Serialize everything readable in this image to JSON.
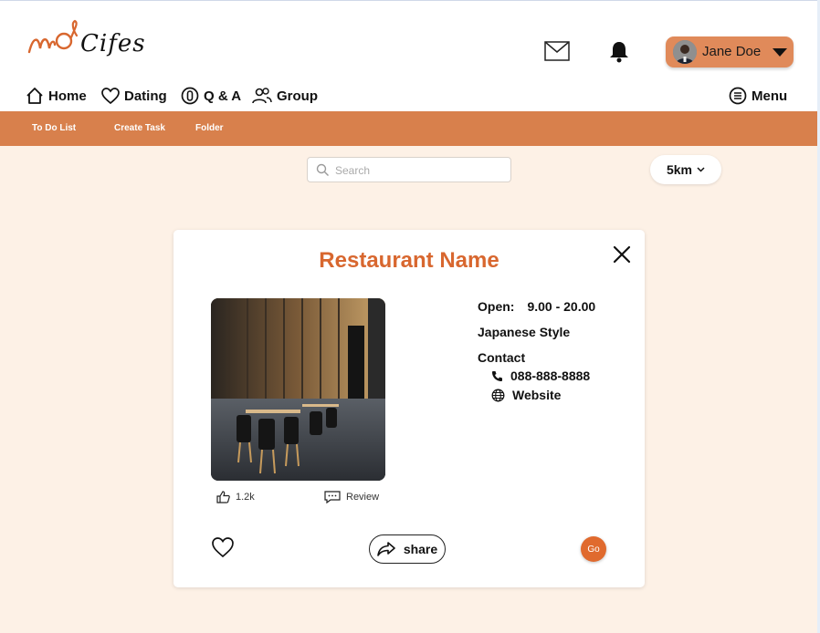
{
  "app": {
    "logo_text": "Cifes",
    "accent_color": "#d8804c",
    "title_color": "#d8672f"
  },
  "header": {
    "icons": [
      "mail-icon",
      "bell-icon"
    ],
    "user": {
      "name": "Jane Doe"
    }
  },
  "nav": {
    "home": "Home",
    "dating": "Dating",
    "qa": "Q & A",
    "group": "Group",
    "menu": "Menu"
  },
  "subnav": {
    "todo": "To Do List",
    "create": "Create Task",
    "folder": "Folder"
  },
  "search": {
    "placeholder": "Search",
    "value": ""
  },
  "filter": {
    "distance": "5km"
  },
  "card": {
    "title": "Restaurant Name",
    "likes": "1.2k",
    "review_label": "Review",
    "open_label": "Open:",
    "open_hours": "9.00 - 20.00",
    "style": "Japanese Style",
    "contact_label": "Contact",
    "phone": "088-888-8888",
    "website": "Website",
    "share_label": "share",
    "go_label": "Go"
  }
}
